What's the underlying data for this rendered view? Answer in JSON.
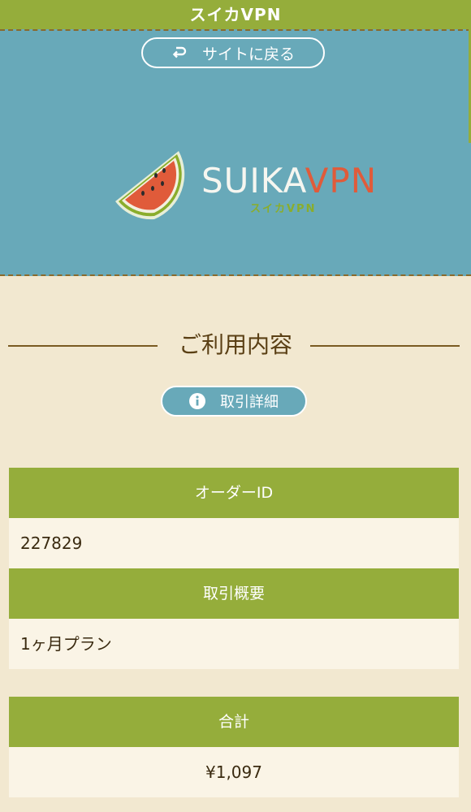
{
  "header": {
    "title": "スイカVPN"
  },
  "hero": {
    "back_label": "サイトに戻る",
    "logo_main_a": "SUIKA",
    "logo_main_b": "VPN",
    "logo_sub": "スイカVPN"
  },
  "section": {
    "title": "ご利用内容",
    "detail_label": "取引詳細"
  },
  "order": {
    "id_header": "オーダーID",
    "id_value": "227829",
    "summary_header": "取引概要",
    "summary_value": "1ヶ月プラン"
  },
  "total": {
    "header": "合計",
    "value": "¥1,097"
  },
  "colors": {
    "accent_green": "#95ad3b",
    "hero_blue": "#68a9b9",
    "page_bg": "#f2e8d0",
    "logo_red": "#e05b3a"
  },
  "icons": {
    "back": "return-arrow-icon",
    "info": "info-icon",
    "logo": "watermelon-icon"
  }
}
